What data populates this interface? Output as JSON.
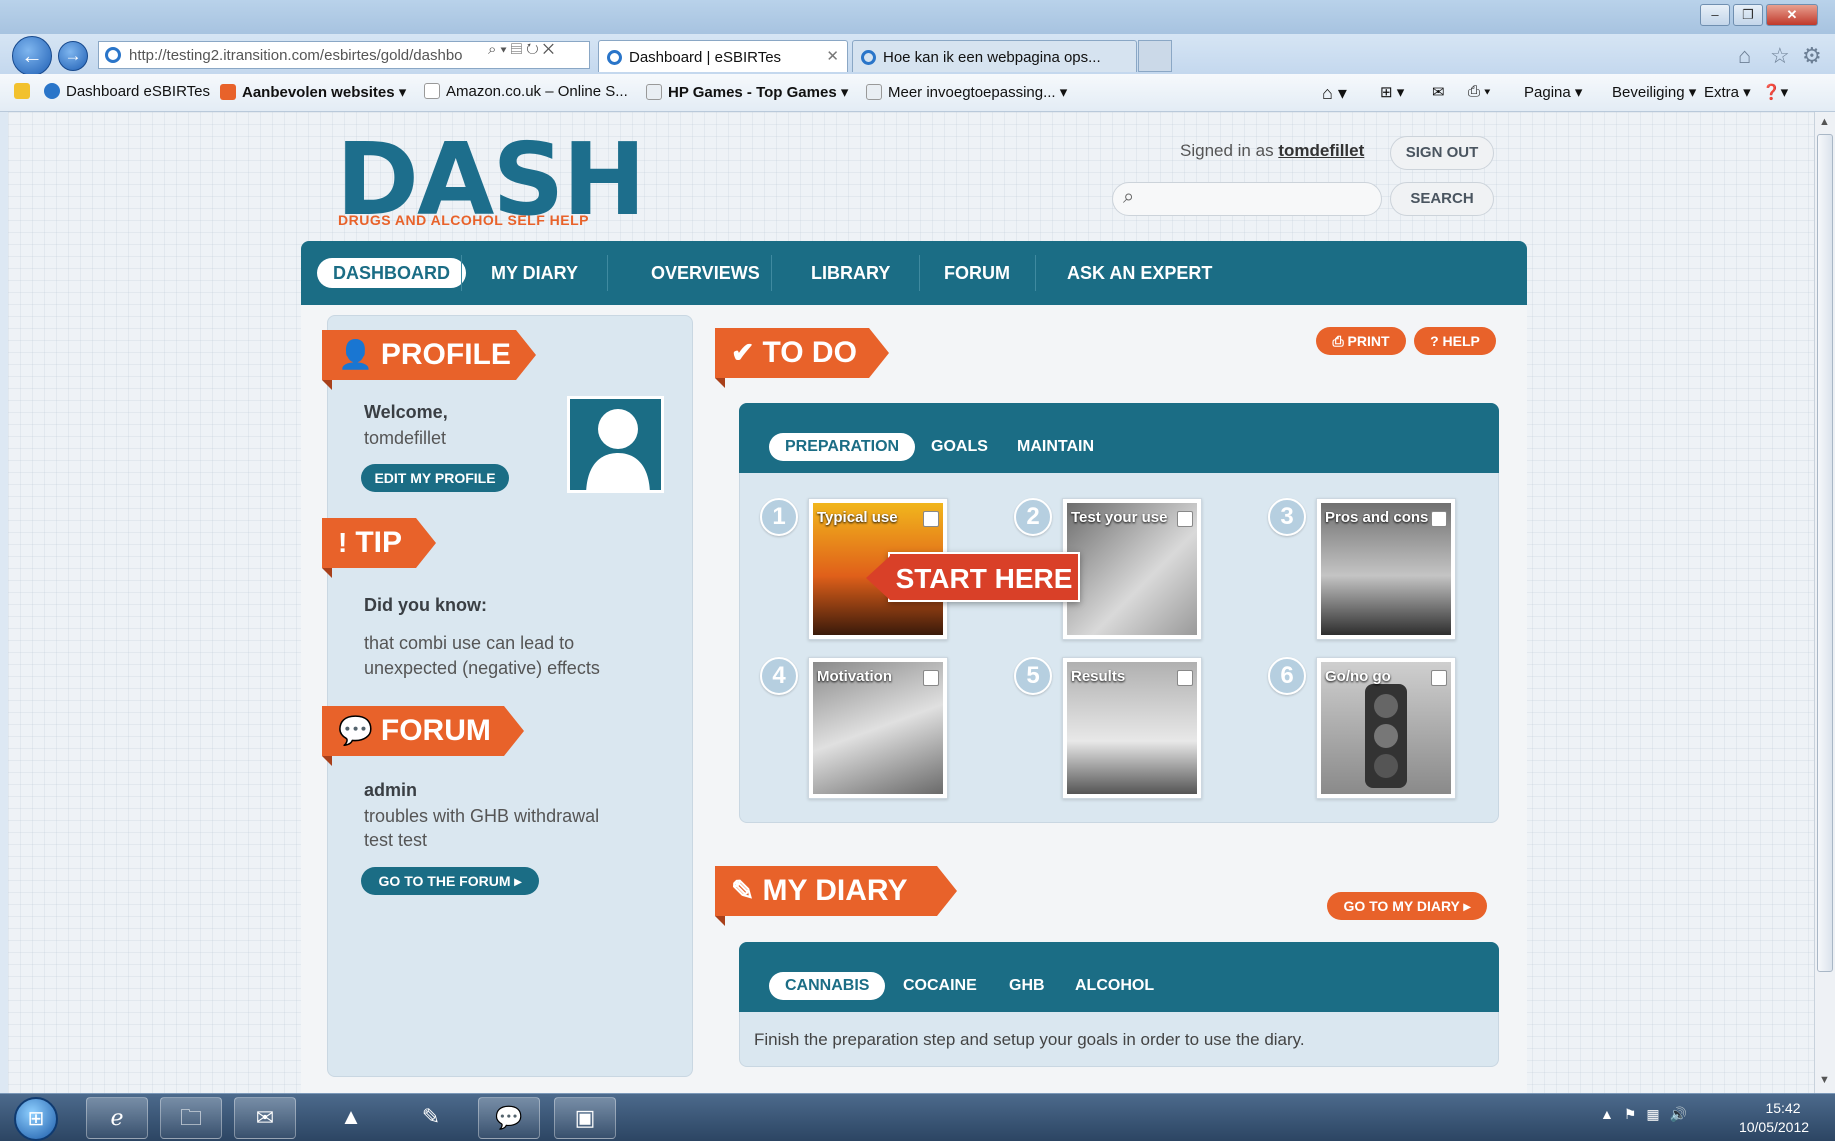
{
  "browser": {
    "url": "http://testing2.itransition.com/esbirtes/gold/dashbo",
    "tabs": [
      {
        "title": "Dashboard | eSBIRTes"
      },
      {
        "title": "Hoe kan ik een webpagina ops..."
      }
    ],
    "favorites": [
      {
        "label": "Dashboard  eSBIRTes"
      },
      {
        "label": "Aanbevolen websites"
      },
      {
        "label": "Amazon.co.uk – Online S..."
      },
      {
        "label": "HP Games - Top Games"
      },
      {
        "label": "Meer invoegtoepassing..."
      }
    ],
    "commands": [
      "Pagina",
      "Beveiliging",
      "Extra"
    ]
  },
  "header": {
    "logo_text": "DASH",
    "logo_tagline": "DRUGS AND ALCOHOL SELF HELP",
    "signed_in_prefix": "Signed in as",
    "username": "tomdefillet",
    "sign_out": "SIGN OUT",
    "search_placeholder": "",
    "search_button": "SEARCH"
  },
  "nav": {
    "items": [
      "DASHBOARD",
      "MY DIARY",
      "OVERVIEWS",
      "LIBRARY",
      "FORUM",
      "ASK AN EXPERT"
    ]
  },
  "sidebar": {
    "profile": {
      "title": "PROFILE",
      "welcome": "Welcome,",
      "name": "tomdefillet",
      "edit_button": "EDIT MY PROFILE"
    },
    "tip": {
      "title": "TIP",
      "heading": "Did you know:",
      "text": "that combi use can lead to unexpected (negative) effects"
    },
    "forum": {
      "title": "FORUM",
      "user": "admin",
      "topic": "troubles with GHB withdrawal",
      "text": "test test",
      "button": "GO TO THE FORUM"
    }
  },
  "todo": {
    "title": "TO DO",
    "print": "PRINT",
    "help": "HELP",
    "tabs": [
      "PREPARATION",
      "GOALS",
      "MAINTAIN"
    ],
    "start_here": "START HERE",
    "steps": [
      {
        "num": "1",
        "label": "Typical use"
      },
      {
        "num": "2",
        "label": "Test your use"
      },
      {
        "num": "3",
        "label": "Pros and cons"
      },
      {
        "num": "4",
        "label": "Motivation"
      },
      {
        "num": "5",
        "label": "Results"
      },
      {
        "num": "6",
        "label": "Go/no go"
      }
    ]
  },
  "diary": {
    "title": "MY DIARY",
    "button": "GO TO MY DIARY",
    "tabs": [
      "CANNABIS",
      "COCAINE",
      "GHB",
      "ALCOHOL"
    ],
    "message": "Finish the preparation step and setup your goals in order to use the diary."
  },
  "taskbar": {
    "time": "15:42",
    "date": "10/05/2012"
  },
  "colors": {
    "brand_teal": "#1b6d85",
    "accent_orange": "#e8622a",
    "start_red": "#d94028"
  }
}
